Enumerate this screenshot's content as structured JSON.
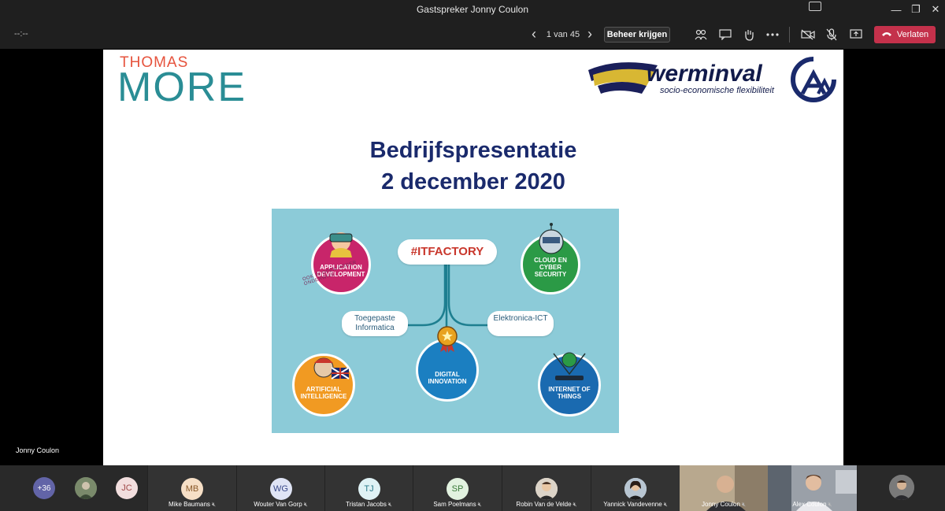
{
  "window": {
    "title": "Gastspreker Jonny Coulon"
  },
  "toolbar": {
    "timer": "--:--",
    "page_counter": "1 van 45",
    "take_control_label": "Beheer krijgen",
    "leave_label": "Verlaten"
  },
  "slide": {
    "logo_thomas": "THOMAS",
    "logo_more": "MORE",
    "werminval_name": "werminval",
    "werminval_tagline": "socio-economische flexibiliteit",
    "title_line1": "Bedrijfspresentatie",
    "title_line2": "2 december 2020",
    "itfactory": {
      "main": "#ITFACTORY",
      "left_branch": "Toegepaste Informatica",
      "right_branch": "Elektronica-ICT",
      "nodes": {
        "app_dev": "APPLICATION DEVELOPMENT",
        "app_dev_curve": "OOK IN OPEN HOGER ONDERWIJS",
        "cloud": "CLOUD EN CYBER SECURITY",
        "digital": "DIGITAL INNOVATION",
        "ai": "ARTIFICIAL INTELLIGENCE",
        "iot": "INTERNET OF THINGS"
      }
    }
  },
  "presenter_name": "Jonny Coulon",
  "participants": {
    "more_count": "+36",
    "jc_initials": "JC",
    "tiles": [
      {
        "name": "Mike Baumans",
        "initials": "MB"
      },
      {
        "name": "Wouter Van Gorp",
        "initials": "WG"
      },
      {
        "name": "Tristan Jacobs",
        "initials": "TJ"
      },
      {
        "name": "Sam Poelmans",
        "initials": "SP"
      },
      {
        "name": "Robin Van de Velde",
        "initials": ""
      },
      {
        "name": "Yannick Vandevenne",
        "initials": ""
      },
      {
        "name": "Jonny Coulon",
        "initials": ""
      },
      {
        "name": "Alex Coulon",
        "initials": ""
      }
    ]
  },
  "colors": {
    "leave": "#c4314b",
    "slide_title": "#1a2a6c",
    "app_dev": "#c8256a",
    "cloud": "#2b9a46",
    "digital": "#1b7fc1",
    "ai": "#f19a22",
    "iot": "#1a6ab0"
  }
}
